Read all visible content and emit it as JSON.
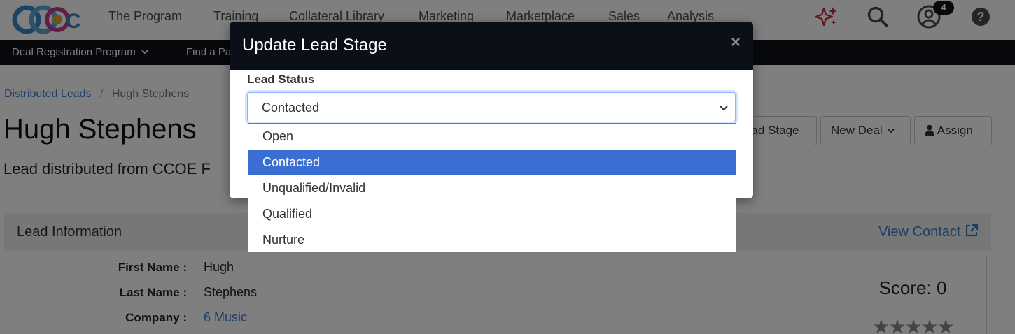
{
  "nav": {
    "logo_text": "CCOE",
    "items": [
      "The Program",
      "Training",
      "Collateral Library",
      "Marketing",
      "Marketplace",
      "Sales",
      "Analysis"
    ],
    "notification_count": "4",
    "icons": [
      "sparkle-icon",
      "search-icon",
      "user-icon",
      "help-icon"
    ],
    "sparkle_color": "#c0243a"
  },
  "subnav": {
    "items": [
      "Deal Registration Program",
      "Find a Pa"
    ]
  },
  "breadcrumb": {
    "link": "Distributed Leads",
    "separator": "/",
    "current": "Hugh Stephens"
  },
  "page": {
    "title": "Hugh Stephens",
    "subtitle": "Lead distributed from CCOE F",
    "buttons": {
      "update_stage": "Update Lead Stage",
      "new_deal": "New Deal",
      "assign": "Assign"
    }
  },
  "lead_info": {
    "heading": "Lead Information",
    "view_contact": "View Contact",
    "fields": [
      {
        "label": "First Name :",
        "value": "Hugh"
      },
      {
        "label": "Last Name :",
        "value": "Stephens"
      },
      {
        "label": "Company :",
        "value": "6 Music"
      }
    ],
    "score_label": "Score: 0",
    "stars": "★★★★★",
    "rating": 0
  },
  "modal": {
    "title": "Update Lead Stage",
    "close": "×",
    "field_label": "Lead Status",
    "selected_value": "Contacted",
    "options": [
      "Open",
      "Contacted",
      "Unqualified/Invalid",
      "Qualified",
      "Nurture"
    ],
    "highlight_color": "#3b6ed3"
  }
}
